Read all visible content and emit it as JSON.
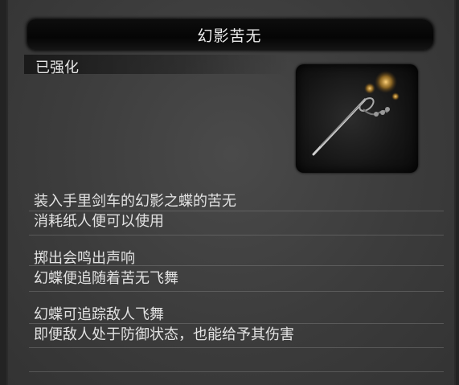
{
  "item": {
    "name": "幻影苦无",
    "status": "已强化",
    "icon": "kunai-icon"
  },
  "description": [
    [
      "装入手里剑车的幻影之蝶的苦无",
      "消耗纸人便可以使用"
    ],
    [
      "掷出会鸣出声响",
      "幻蝶便追随着苦无飞舞"
    ],
    [
      "幻蝶可追踪敌人飞舞",
      "即便敌人处于防御状态，也能给予其伤害"
    ]
  ]
}
